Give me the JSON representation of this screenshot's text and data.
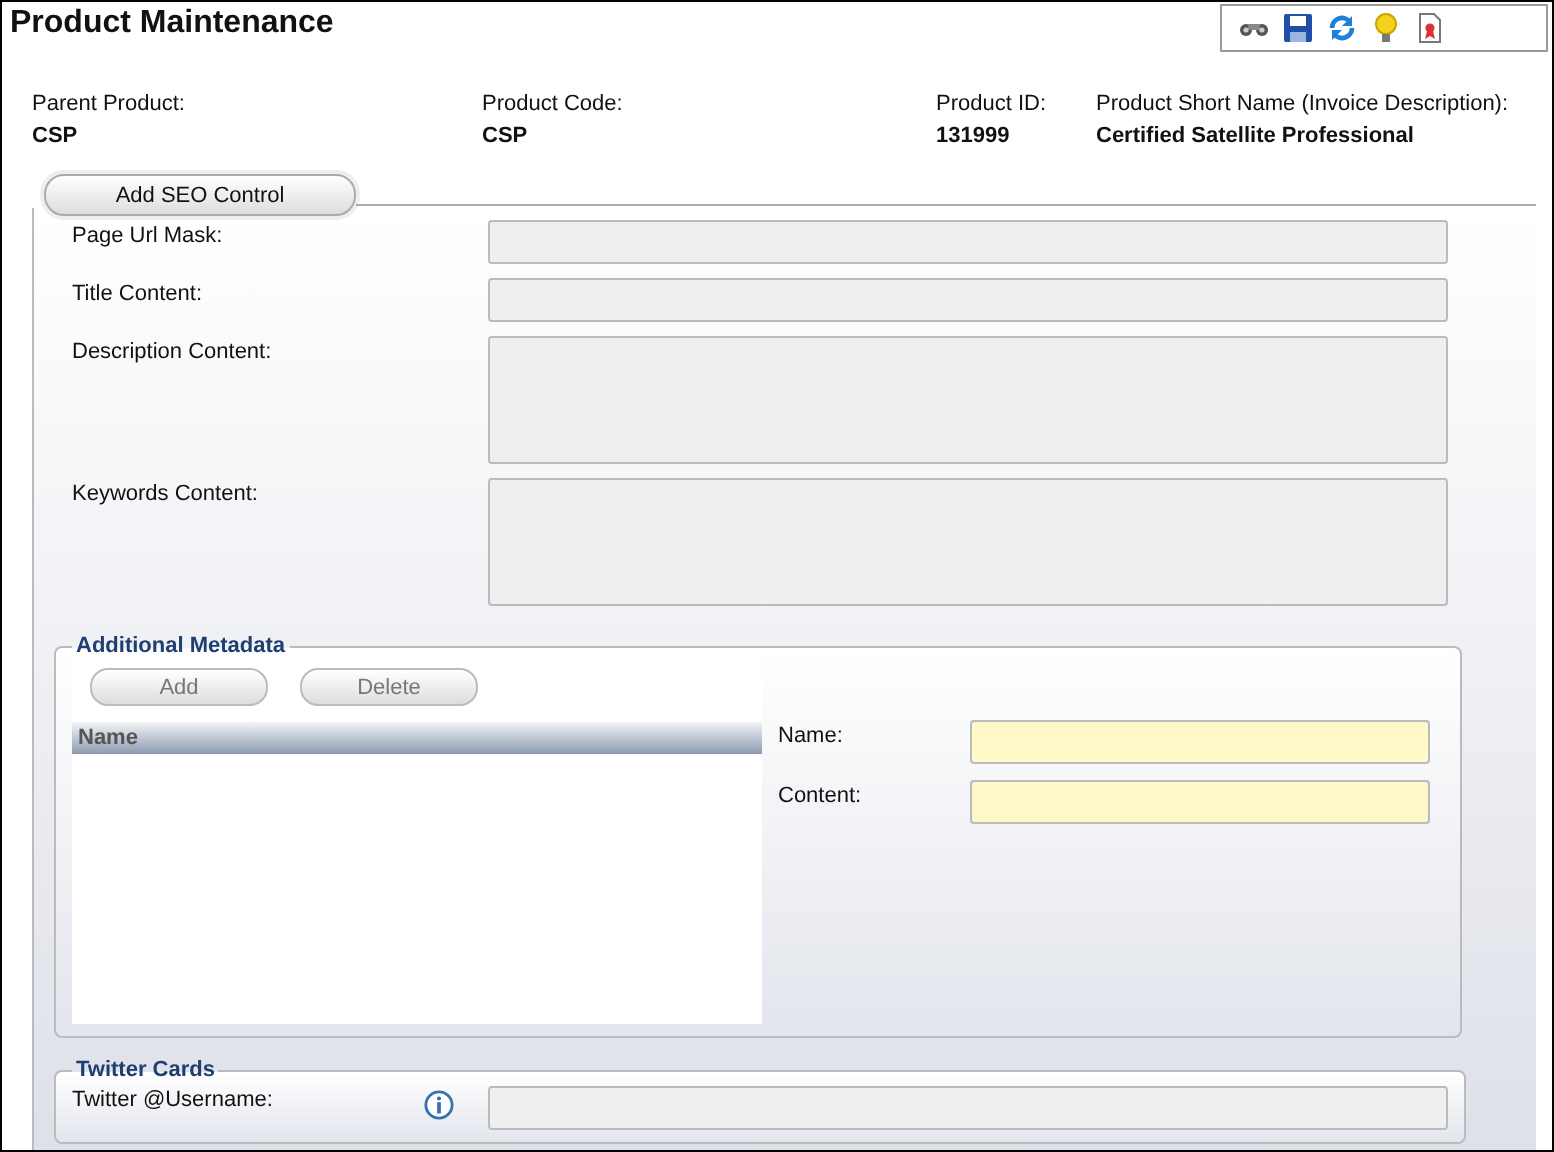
{
  "window": {
    "title": "Product Maintenance"
  },
  "header_fields": [
    {
      "label": "Parent Product:",
      "value": "CSP"
    },
    {
      "label": "Product Code:",
      "value": "CSP"
    },
    {
      "label": "Product ID:",
      "value": "131999"
    },
    {
      "label": "Product Short Name (Invoice Description):",
      "value": "Certified Satellite Professional"
    }
  ],
  "seo_tab": {
    "label": "Add SEO Control"
  },
  "seo_fields": [
    {
      "label": "Page Url Mask:",
      "kind": "single"
    },
    {
      "label": "Title Content:",
      "kind": "single"
    },
    {
      "label": "Description Content:",
      "kind": "multi"
    },
    {
      "label": "Keywords Content:",
      "kind": "multi"
    }
  ],
  "additional_metadata": {
    "legend": "Additional Metadata",
    "buttons": [
      {
        "label": "Add",
        "disabled": true
      },
      {
        "label": "Delete",
        "disabled": true
      }
    ],
    "grid": {
      "columns": [
        "Name"
      ]
    },
    "fields": [
      {
        "label": "Name:",
        "required": true
      },
      {
        "label": "Content:",
        "required": true
      }
    ]
  },
  "twitter_cards": {
    "legend": "Twitter Cards",
    "fields": [
      {
        "label": "Twitter @Username:",
        "info": true
      }
    ]
  }
}
